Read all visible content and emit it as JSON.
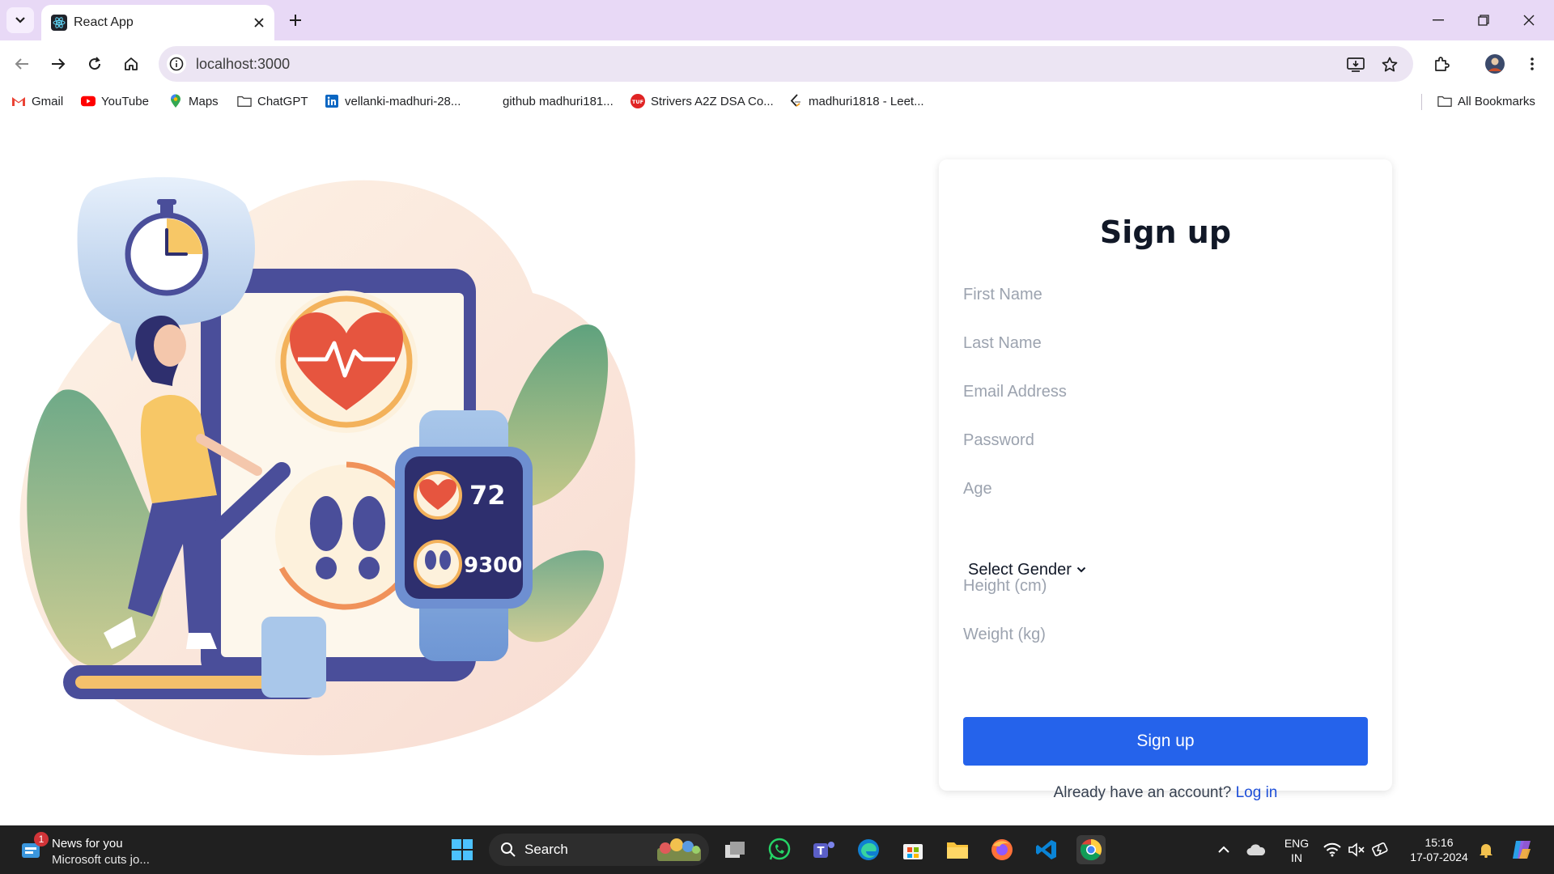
{
  "browser": {
    "tab_title": "React App",
    "url": "localhost:3000",
    "bookmarks": [
      {
        "label": "Gmail",
        "icon": "gmail-icon"
      },
      {
        "label": "YouTube",
        "icon": "youtube-icon"
      },
      {
        "label": "Maps",
        "icon": "maps-icon"
      },
      {
        "label": "ChatGPT",
        "icon": "folder-icon"
      },
      {
        "label": "vellanki-madhuri-28...",
        "icon": "linkedin-icon"
      },
      {
        "label": "github madhuri181...",
        "icon": "none"
      },
      {
        "label": "Strivers A2Z DSA Co...",
        "icon": "tuf-icon"
      },
      {
        "label": "madhuri1818 - Leet...",
        "icon": "leetcode-icon"
      }
    ],
    "all_bookmarks": "All Bookmarks"
  },
  "illustration": {
    "watch_heart_rate": "72",
    "watch_steps": "9300"
  },
  "form": {
    "title": "Sign up",
    "first_name_placeholder": "First Name",
    "last_name_placeholder": "Last Name",
    "email_placeholder": "Email Address",
    "password_placeholder": "Password",
    "age_placeholder": "Age",
    "gender_select": "Select Gender",
    "height_placeholder": "Height (cm)",
    "weight_placeholder": "Weight (kg)",
    "submit_label": "Sign up",
    "login_prompt": "Already have an account?",
    "login_link": "Log in"
  },
  "taskbar": {
    "news_badge": "1",
    "news_title": "News for you",
    "news_subtitle": "Microsoft cuts jo...",
    "search_label": "Search",
    "language_line1": "ENG",
    "language_line2": "IN",
    "time": "15:16",
    "date": "17-07-2024"
  },
  "colors": {
    "tab_strip": "#e8d9f6",
    "primary_button": "#2563eb",
    "link": "#1d4ed8"
  }
}
